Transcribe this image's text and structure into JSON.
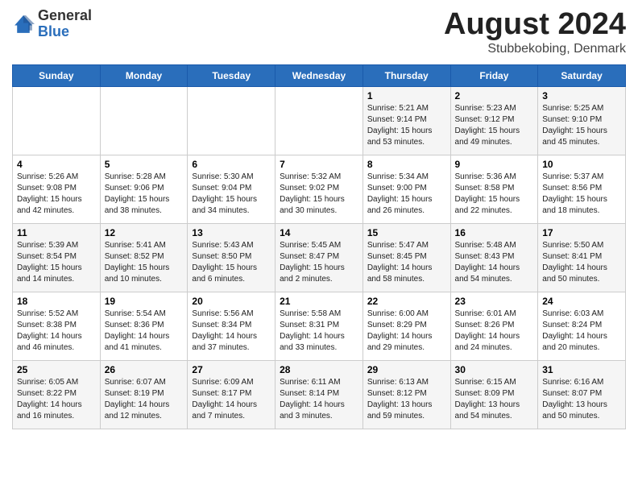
{
  "header": {
    "logo_general": "General",
    "logo_blue": "Blue",
    "month": "August 2024",
    "location": "Stubbekobing, Denmark"
  },
  "days_of_week": [
    "Sunday",
    "Monday",
    "Tuesday",
    "Wednesday",
    "Thursday",
    "Friday",
    "Saturday"
  ],
  "weeks": [
    [
      {
        "day": "",
        "content": ""
      },
      {
        "day": "",
        "content": ""
      },
      {
        "day": "",
        "content": ""
      },
      {
        "day": "",
        "content": ""
      },
      {
        "day": "1",
        "content": "Sunrise: 5:21 AM\nSunset: 9:14 PM\nDaylight: 15 hours\nand 53 minutes."
      },
      {
        "day": "2",
        "content": "Sunrise: 5:23 AM\nSunset: 9:12 PM\nDaylight: 15 hours\nand 49 minutes."
      },
      {
        "day": "3",
        "content": "Sunrise: 5:25 AM\nSunset: 9:10 PM\nDaylight: 15 hours\nand 45 minutes."
      }
    ],
    [
      {
        "day": "4",
        "content": "Sunrise: 5:26 AM\nSunset: 9:08 PM\nDaylight: 15 hours\nand 42 minutes."
      },
      {
        "day": "5",
        "content": "Sunrise: 5:28 AM\nSunset: 9:06 PM\nDaylight: 15 hours\nand 38 minutes."
      },
      {
        "day": "6",
        "content": "Sunrise: 5:30 AM\nSunset: 9:04 PM\nDaylight: 15 hours\nand 34 minutes."
      },
      {
        "day": "7",
        "content": "Sunrise: 5:32 AM\nSunset: 9:02 PM\nDaylight: 15 hours\nand 30 minutes."
      },
      {
        "day": "8",
        "content": "Sunrise: 5:34 AM\nSunset: 9:00 PM\nDaylight: 15 hours\nand 26 minutes."
      },
      {
        "day": "9",
        "content": "Sunrise: 5:36 AM\nSunset: 8:58 PM\nDaylight: 15 hours\nand 22 minutes."
      },
      {
        "day": "10",
        "content": "Sunrise: 5:37 AM\nSunset: 8:56 PM\nDaylight: 15 hours\nand 18 minutes."
      }
    ],
    [
      {
        "day": "11",
        "content": "Sunrise: 5:39 AM\nSunset: 8:54 PM\nDaylight: 15 hours\nand 14 minutes."
      },
      {
        "day": "12",
        "content": "Sunrise: 5:41 AM\nSunset: 8:52 PM\nDaylight: 15 hours\nand 10 minutes."
      },
      {
        "day": "13",
        "content": "Sunrise: 5:43 AM\nSunset: 8:50 PM\nDaylight: 15 hours\nand 6 minutes."
      },
      {
        "day": "14",
        "content": "Sunrise: 5:45 AM\nSunset: 8:47 PM\nDaylight: 15 hours\nand 2 minutes."
      },
      {
        "day": "15",
        "content": "Sunrise: 5:47 AM\nSunset: 8:45 PM\nDaylight: 14 hours\nand 58 minutes."
      },
      {
        "day": "16",
        "content": "Sunrise: 5:48 AM\nSunset: 8:43 PM\nDaylight: 14 hours\nand 54 minutes."
      },
      {
        "day": "17",
        "content": "Sunrise: 5:50 AM\nSunset: 8:41 PM\nDaylight: 14 hours\nand 50 minutes."
      }
    ],
    [
      {
        "day": "18",
        "content": "Sunrise: 5:52 AM\nSunset: 8:38 PM\nDaylight: 14 hours\nand 46 minutes."
      },
      {
        "day": "19",
        "content": "Sunrise: 5:54 AM\nSunset: 8:36 PM\nDaylight: 14 hours\nand 41 minutes."
      },
      {
        "day": "20",
        "content": "Sunrise: 5:56 AM\nSunset: 8:34 PM\nDaylight: 14 hours\nand 37 minutes."
      },
      {
        "day": "21",
        "content": "Sunrise: 5:58 AM\nSunset: 8:31 PM\nDaylight: 14 hours\nand 33 minutes."
      },
      {
        "day": "22",
        "content": "Sunrise: 6:00 AM\nSunset: 8:29 PM\nDaylight: 14 hours\nand 29 minutes."
      },
      {
        "day": "23",
        "content": "Sunrise: 6:01 AM\nSunset: 8:26 PM\nDaylight: 14 hours\nand 24 minutes."
      },
      {
        "day": "24",
        "content": "Sunrise: 6:03 AM\nSunset: 8:24 PM\nDaylight: 14 hours\nand 20 minutes."
      }
    ],
    [
      {
        "day": "25",
        "content": "Sunrise: 6:05 AM\nSunset: 8:22 PM\nDaylight: 14 hours\nand 16 minutes."
      },
      {
        "day": "26",
        "content": "Sunrise: 6:07 AM\nSunset: 8:19 PM\nDaylight: 14 hours\nand 12 minutes."
      },
      {
        "day": "27",
        "content": "Sunrise: 6:09 AM\nSunset: 8:17 PM\nDaylight: 14 hours\nand 7 minutes."
      },
      {
        "day": "28",
        "content": "Sunrise: 6:11 AM\nSunset: 8:14 PM\nDaylight: 14 hours\nand 3 minutes."
      },
      {
        "day": "29",
        "content": "Sunrise: 6:13 AM\nSunset: 8:12 PM\nDaylight: 13 hours\nand 59 minutes."
      },
      {
        "day": "30",
        "content": "Sunrise: 6:15 AM\nSunset: 8:09 PM\nDaylight: 13 hours\nand 54 minutes."
      },
      {
        "day": "31",
        "content": "Sunrise: 6:16 AM\nSunset: 8:07 PM\nDaylight: 13 hours\nand 50 minutes."
      }
    ]
  ]
}
